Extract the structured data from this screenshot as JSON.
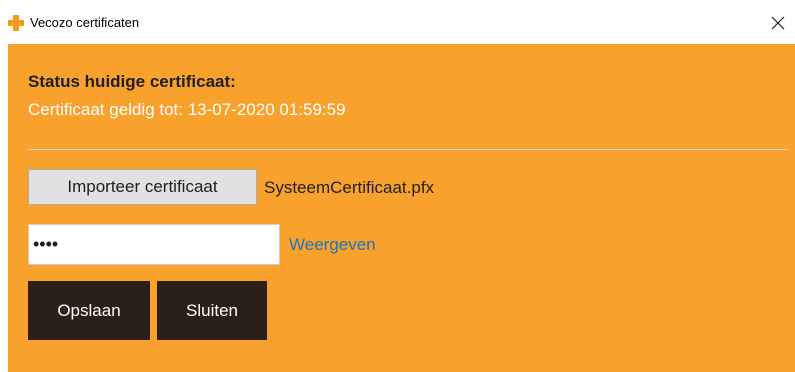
{
  "window": {
    "title": "Vecozo certificaten",
    "close_glyph": "✕"
  },
  "status": {
    "heading": "Status huidige certificaat:",
    "detail": "Certificaat geldig tot: 13-07-2020 01:59:59"
  },
  "import": {
    "button_label": "Importeer certificaat",
    "file_name": "SysteemCertificaat.pfx"
  },
  "password": {
    "value": "••••",
    "show_label": "Weergeven"
  },
  "actions": {
    "save_label": "Opslaan",
    "close_label": "Sluiten"
  },
  "colors": {
    "accent": "#f8a22d",
    "dark_button": "#2a2017",
    "link": "#1f74b5",
    "status_text": "#ffffff"
  },
  "icons": {
    "app": "plus-icon",
    "close": "close-icon"
  }
}
